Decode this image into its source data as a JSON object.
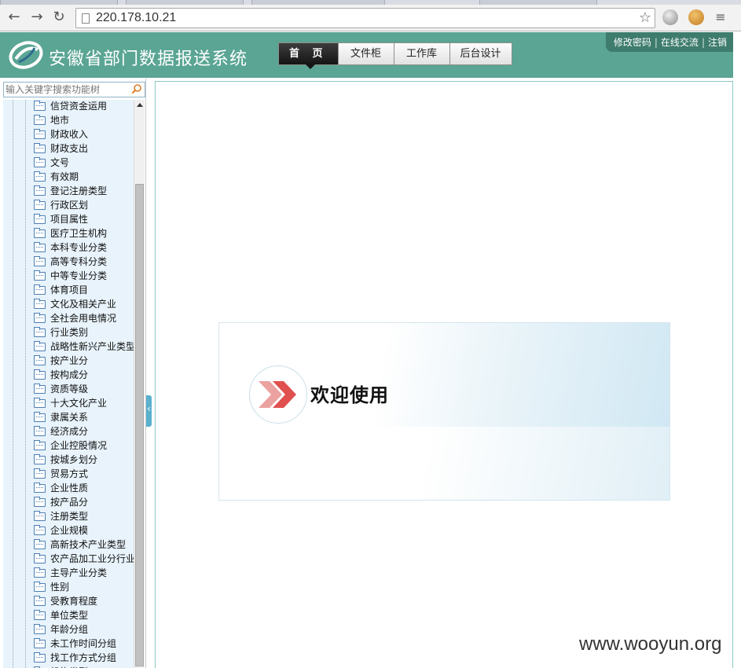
{
  "browser": {
    "url": "220.178.10.21",
    "back_icon": "arrow-left",
    "forward_icon": "arrow-right",
    "reload_icon": "reload"
  },
  "header": {
    "title": "安徽省部门数据报送系统",
    "nav_tabs": [
      {
        "label": "首 页"
      },
      {
        "label": "文件柜"
      },
      {
        "label": "工作库"
      },
      {
        "label": "后台设计"
      }
    ],
    "user_links": [
      {
        "label": "修改密码"
      },
      {
        "label": "在线交流"
      },
      {
        "label": "注销"
      }
    ]
  },
  "sidebar": {
    "search_placeholder": "输入关键字搜索功能树",
    "items": [
      {
        "label": "信贷资金运用"
      },
      {
        "label": "地市"
      },
      {
        "label": "财政收入"
      },
      {
        "label": "财政支出"
      },
      {
        "label": "文号"
      },
      {
        "label": "有效期"
      },
      {
        "label": "登记注册类型"
      },
      {
        "label": "行政区划"
      },
      {
        "label": "项目属性"
      },
      {
        "label": "医疗卫生机构"
      },
      {
        "label": "本科专业分类"
      },
      {
        "label": "高等专科分类"
      },
      {
        "label": "中等专业分类"
      },
      {
        "label": "体育项目"
      },
      {
        "label": "文化及相关产业"
      },
      {
        "label": "全社会用电情况"
      },
      {
        "label": "行业类别"
      },
      {
        "label": "战略性新兴产业类型"
      },
      {
        "label": "按产业分"
      },
      {
        "label": "按构成分"
      },
      {
        "label": "资质等级"
      },
      {
        "label": "十大文化产业"
      },
      {
        "label": "隶属关系"
      },
      {
        "label": "经济成分"
      },
      {
        "label": "企业控股情况"
      },
      {
        "label": "按城乡划分"
      },
      {
        "label": "贸易方式"
      },
      {
        "label": "企业性质"
      },
      {
        "label": "按产品分"
      },
      {
        "label": "注册类型"
      },
      {
        "label": "企业规模"
      },
      {
        "label": "高新技术产业类型"
      },
      {
        "label": "农产品加工业分行业"
      },
      {
        "label": "主导产业分类"
      },
      {
        "label": "性别"
      },
      {
        "label": "受教育程度"
      },
      {
        "label": "单位类型"
      },
      {
        "label": "年龄分组"
      },
      {
        "label": "未工作时间分组"
      },
      {
        "label": "找工作方式分组"
      },
      {
        "label": "机构类型"
      }
    ]
  },
  "main": {
    "welcome_text": "欢迎使用"
  },
  "watermark": "www.wooyun.org",
  "colors": {
    "header_bg": "#5aa594",
    "tree_bg": "#e8f3fb",
    "accent_red": "#e0504e"
  }
}
